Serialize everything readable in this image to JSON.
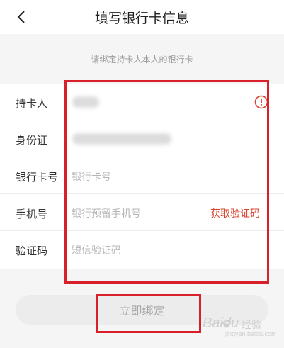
{
  "header": {
    "title": "填写银行卡信息",
    "back_icon": "chevron-left-icon"
  },
  "hint": "请绑定持卡人本人的银行卡",
  "form": {
    "rows": [
      {
        "label": "持卡人",
        "value": "",
        "blurred": true,
        "icon": "warning-circle-icon"
      },
      {
        "label": "身份证",
        "value": "",
        "blurred": true
      },
      {
        "label": "银行卡号",
        "placeholder": "银行卡号"
      },
      {
        "label": "手机号",
        "placeholder": "银行预留手机号",
        "action": "获取验证码"
      },
      {
        "label": "验证码",
        "placeholder": "短信验证码"
      }
    ]
  },
  "submit": {
    "label": "立即绑定",
    "enabled": false
  },
  "watermark": {
    "brand": "Baidu",
    "product": "经验",
    "url": "jingyan.baidu.com"
  },
  "colors": {
    "accent": "#d9422e",
    "annotation": "#d8202b",
    "background": "#f5f5f5",
    "placeholder": "#b5b5b5"
  }
}
